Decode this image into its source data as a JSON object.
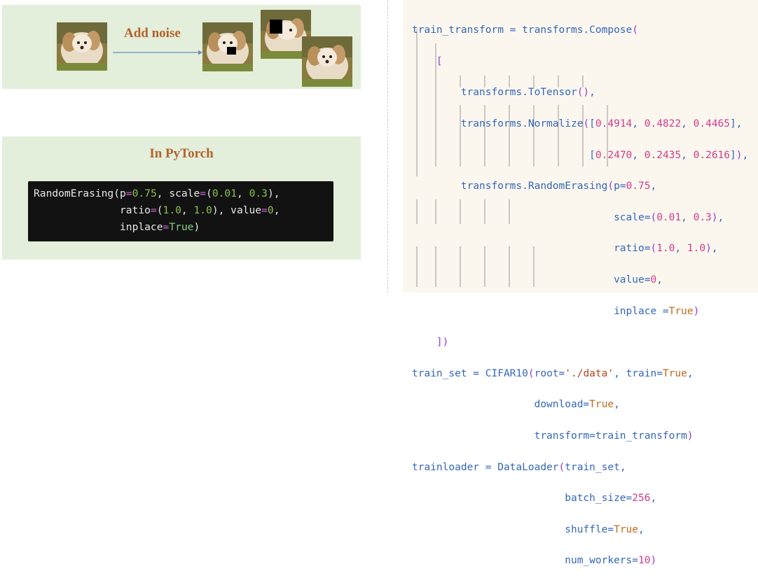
{
  "top": {
    "add_noise_label": "Add noise"
  },
  "bottom": {
    "title": "In PyTorch",
    "code_lines": [
      "RandomErasing(p=0.75, scale=(0.01, 0.3),",
      "              ratio=(1.0, 1.0), value=0,",
      "              inplace=True)"
    ]
  },
  "right_code": {
    "lines": [
      "train_transform = transforms.Compose(",
      "    [",
      "        transforms.ToTensor(),",
      "        transforms.Normalize([0.4914, 0.4822, 0.4465],",
      "                             [0.2470, 0.2435, 0.2616]),",
      "        transforms.RandomErasing(p=0.75,",
      "                                 scale=(0.01, 0.3),",
      "                                 ratio=(1.0, 1.0),",
      "                                 value=0,",
      "                                 inplace =True)",
      "    ])",
      "train_set = CIFAR10(root='./data', train=True,",
      "                    download=True,",
      "                    transform=train_transform)",
      "trainloader = DataLoader(train_set,",
      "                         batch_size=256,",
      "                         shuffle=True,",
      "                         num_workers=10)"
    ]
  },
  "colors": {
    "panel_bg": "#e3eedb",
    "title_color": "#b5622b",
    "code_bg": "#121212",
    "right_bg": "#fbf7ef",
    "right_text": "#3567b8"
  }
}
